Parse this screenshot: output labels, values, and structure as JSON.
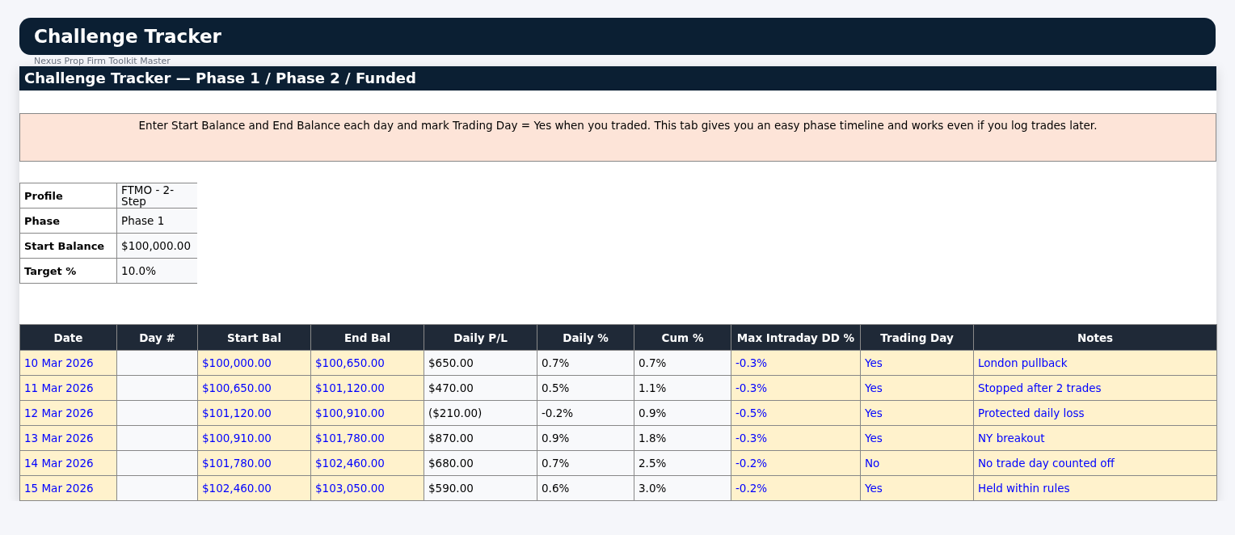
{
  "app_header": {
    "title": "Challenge Tracker",
    "subtitle": "Nexus Prop Firm Toolkit Master"
  },
  "sheet": {
    "title": "Challenge Tracker — Phase 1 / Phase 2 / Funded",
    "note": "Enter Start Balance and End Balance each day and mark Trading Day = Yes when you traded. This tab gives you an easy phase timeline and works even if you log trades later.",
    "summary": [
      {
        "label": "Profile",
        "value": "FTMO - 2-Step"
      },
      {
        "label": "Phase",
        "value": "Phase 1"
      },
      {
        "label": "Start Balance",
        "value": "$100,000.00"
      },
      {
        "label": "Target %",
        "value": "10.0%"
      }
    ],
    "table": {
      "columns": [
        {
          "label": "Date",
          "kind": "input"
        },
        {
          "label": "Day #",
          "kind": "calc"
        },
        {
          "label": "Start Bal",
          "kind": "input"
        },
        {
          "label": "End Bal",
          "kind": "input"
        },
        {
          "label": "Daily P/L",
          "kind": "calc"
        },
        {
          "label": "Daily %",
          "kind": "calc"
        },
        {
          "label": "Cum %",
          "kind": "calc"
        },
        {
          "label": "Max Intraday DD %",
          "kind": "input"
        },
        {
          "label": "Trading Day",
          "kind": "input"
        },
        {
          "label": "Notes",
          "kind": "input"
        }
      ],
      "rows": [
        [
          "10 Mar 2026",
          "",
          "$100,000.00",
          "$100,650.00",
          "$650.00",
          "0.7%",
          "0.7%",
          "-0.3%",
          "Yes",
          "London pullback"
        ],
        [
          "11 Mar 2026",
          "",
          "$100,650.00",
          "$101,120.00",
          "$470.00",
          "0.5%",
          "1.1%",
          "-0.3%",
          "Yes",
          "Stopped after 2 trades"
        ],
        [
          "12 Mar 2026",
          "",
          "$101,120.00",
          "$100,910.00",
          "($210.00)",
          "-0.2%",
          "0.9%",
          "-0.5%",
          "Yes",
          "Protected daily loss"
        ],
        [
          "13 Mar 2026",
          "",
          "$100,910.00",
          "$101,780.00",
          "$870.00",
          "0.9%",
          "1.8%",
          "-0.3%",
          "Yes",
          "NY breakout"
        ],
        [
          "14 Mar 2026",
          "",
          "$101,780.00",
          "$102,460.00",
          "$680.00",
          "0.7%",
          "2.5%",
          "-0.2%",
          "No",
          "No trade day counted off"
        ],
        [
          "15 Mar 2026",
          "",
          "$102,460.00",
          "$103,050.00",
          "$590.00",
          "0.6%",
          "3.0%",
          "-0.2%",
          "Yes",
          "Held within rules"
        ]
      ]
    }
  }
}
